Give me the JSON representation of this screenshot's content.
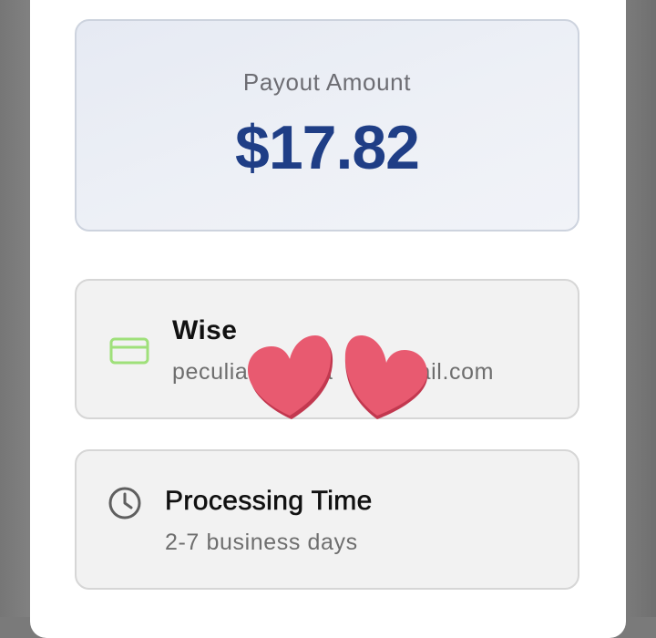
{
  "payout": {
    "label": "Payout Amount",
    "amount": "$17.82"
  },
  "method": {
    "name": "Wise",
    "email": "peculia      a      nail.com",
    "icon": "credit-card-icon",
    "icon_color": "#9fe07a"
  },
  "processing": {
    "title": "Processing Time",
    "detail": "2-7 business days",
    "icon": "clock-icon"
  },
  "overlay": {
    "icon": "heart-stickers",
    "color": "#e85a70"
  },
  "colors": {
    "amount_text": "#1f3e86",
    "backdrop": "#7a7a7a"
  }
}
